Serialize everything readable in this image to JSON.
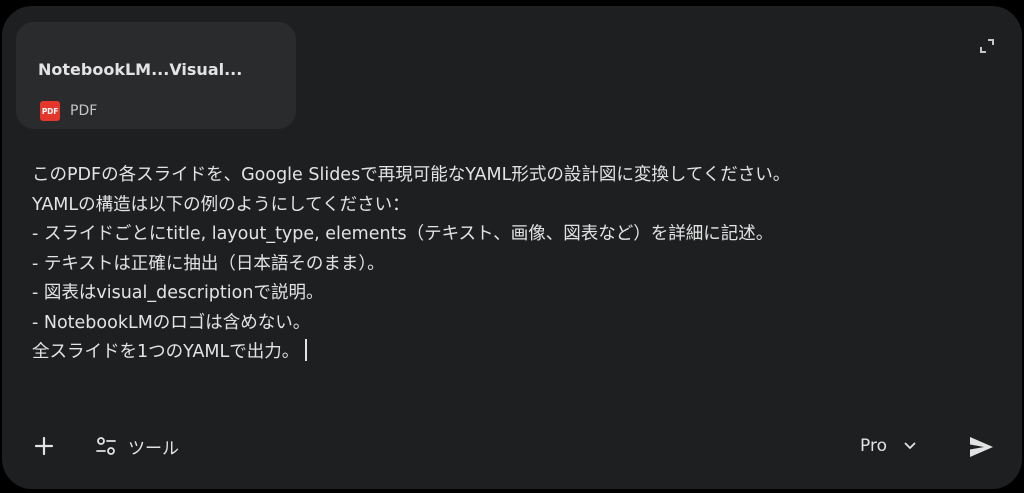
{
  "attachment": {
    "name": "NotebookLM...Visual...",
    "type_label": "PDF",
    "icon_label": "PDF",
    "icon": "pdf-file-icon",
    "icon_color": "#e4362a"
  },
  "composer": {
    "prompt_lines": [
      "このPDFの各スライドを、Google Slidesで再現可能なYAML形式の設計図に変換してください。",
      "YAMLの構造は以下の例のようにしてください：",
      "- スライドごとにtitle, layout_type, elements（テキスト、画像、図表など）を詳細に記述。",
      "- テキストは正確に抽出（日本語そのまま）。",
      "- 図表はvisual_descriptionで説明。",
      "- NotebookLMのロゴは含めない。",
      "全スライドを1つのYAMLで出力。"
    ]
  },
  "toolbar": {
    "add_icon": "plus-icon",
    "tools_icon": "tune-icon",
    "tools_label": "ツール",
    "model_label": "Pro",
    "model_icon": "chevron-down-icon",
    "send_icon": "send-icon",
    "expand_icon": "expand-icon"
  },
  "colors": {
    "background": "#1e1f20",
    "card": "#2a2b2d",
    "text": "#e3e3e3"
  }
}
